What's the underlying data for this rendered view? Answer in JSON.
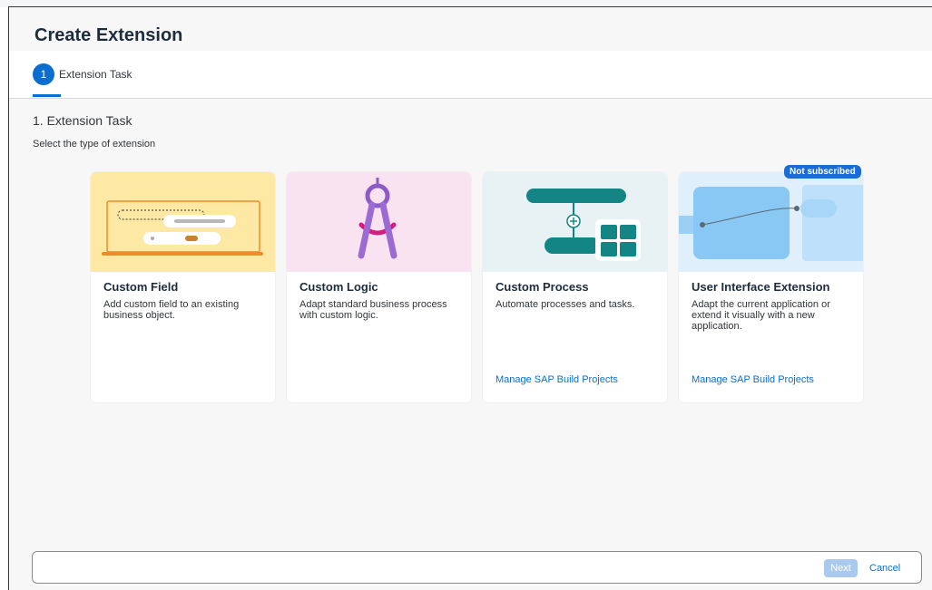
{
  "dialog": {
    "title": "Create Extension"
  },
  "wizard": {
    "steps": [
      {
        "number": "1",
        "label": "Extension Task"
      }
    ]
  },
  "section": {
    "title": "1. Extension Task",
    "subtitle": "Select the type of extension"
  },
  "cards": [
    {
      "title": "Custom Field",
      "description": "Add custom field to an existing business object.",
      "link": "",
      "badge": ""
    },
    {
      "title": "Custom Logic",
      "description": "Adapt standard business process with custom logic.",
      "link": "",
      "badge": ""
    },
    {
      "title": "Custom Process",
      "description": "Automate processes and tasks.",
      "link": "Manage SAP Build Projects",
      "badge": ""
    },
    {
      "title": "User Interface Extension",
      "description": "Adapt the current application or extend it visually with a new application.",
      "link": "Manage SAP Build Projects",
      "badge": "Not subscribed"
    }
  ],
  "footer": {
    "next_label": "Next",
    "cancel_label": "Cancel"
  },
  "colors": {
    "accent": "#0a6ed1",
    "title": "#1d2d3e",
    "next_disabled": "#a9c9ee"
  }
}
